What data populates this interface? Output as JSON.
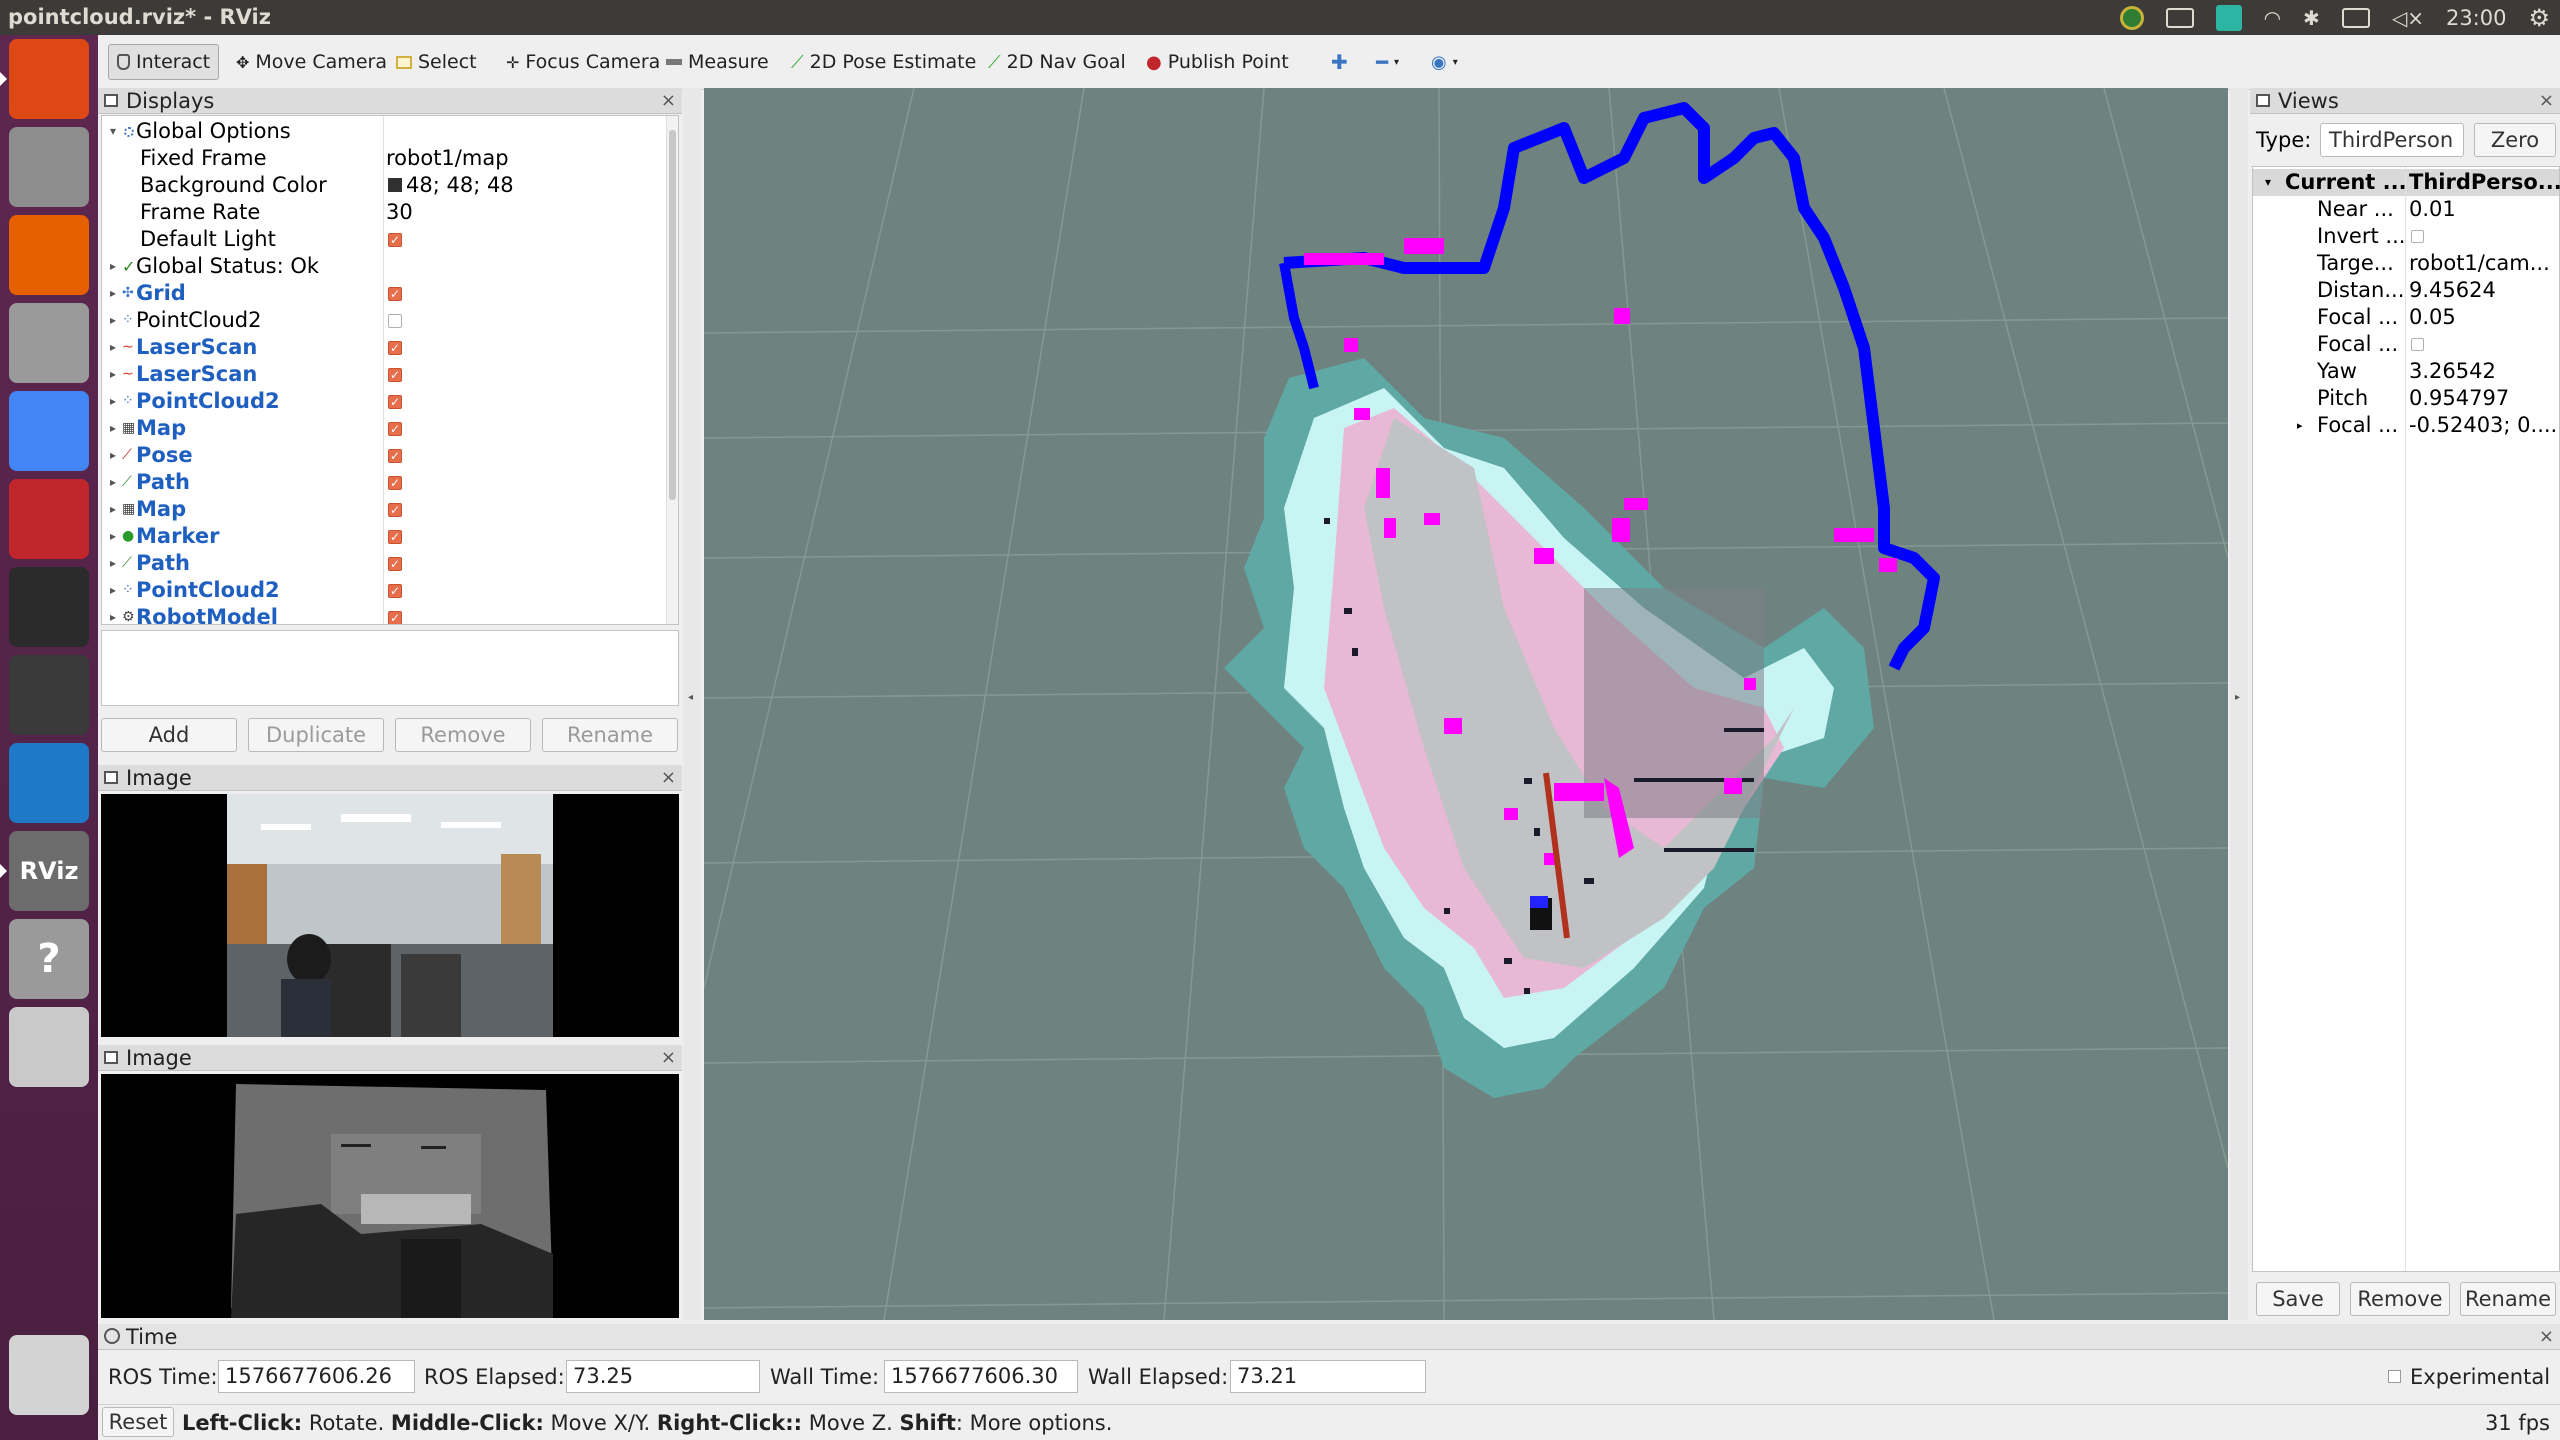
{
  "window": {
    "title": "pointcloud.rviz* - RViz"
  },
  "system_tray": {
    "clock": "23:00"
  },
  "launcher": {
    "items": [
      {
        "name": "ubuntu-dash-icon",
        "color": "#dd4814"
      },
      {
        "name": "files-icon",
        "color": "#8d8d8d"
      },
      {
        "name": "firefox-icon",
        "color": "#e66000"
      },
      {
        "name": "system-settings-icon",
        "color": "#9a9a9a"
      },
      {
        "name": "chrome-icon",
        "color": "#4285f4"
      },
      {
        "name": "terminal-app-icon",
        "color": "#c0262c"
      },
      {
        "name": "system-monitor-icon",
        "color": "#2b2b2b"
      },
      {
        "name": "cheese-camera-icon",
        "color": "#3a3a3a"
      },
      {
        "name": "vscode-icon",
        "color": "#1e7ac9"
      },
      {
        "name": "rviz-icon",
        "color": "#6c6c6c",
        "label": "RViz"
      },
      {
        "name": "help-icon",
        "color": "#9a9a9a",
        "label": "?"
      },
      {
        "name": "disk-icon",
        "color": "#c9c9c9"
      },
      {
        "name": "trash-icon",
        "color": "#d3d3d3"
      }
    ]
  },
  "toolbar": {
    "interact": "Interact",
    "move_camera": "Move Camera",
    "select": "Select",
    "focus_camera": "Focus Camera",
    "measure": "Measure",
    "pose_estimate": "2D Pose Estimate",
    "nav_goal": "2D Nav Goal",
    "publish_point": "Publish Point"
  },
  "displays": {
    "title": "Displays",
    "global_options": "Global Options",
    "props": [
      {
        "key": "Fixed Frame",
        "value": "robot1/map"
      },
      {
        "key": "Background Color",
        "value": "48; 48; 48"
      },
      {
        "key": "Frame Rate",
        "value": "30"
      },
      {
        "key": "Default Light",
        "value": ""
      }
    ],
    "global_status": "Global Status: Ok",
    "items": [
      {
        "label": "Grid",
        "checked": true,
        "bold": true
      },
      {
        "label": "PointCloud2",
        "checked": false,
        "bold": false
      },
      {
        "label": "LaserScan",
        "checked": true,
        "bold": true
      },
      {
        "label": "LaserScan",
        "checked": true,
        "bold": true
      },
      {
        "label": "PointCloud2",
        "checked": true,
        "bold": true
      },
      {
        "label": "Map",
        "checked": true,
        "bold": true
      },
      {
        "label": "Pose",
        "checked": true,
        "bold": true
      },
      {
        "label": "Path",
        "checked": true,
        "bold": true
      },
      {
        "label": "Map",
        "checked": true,
        "bold": true
      },
      {
        "label": "Marker",
        "checked": true,
        "bold": true
      },
      {
        "label": "Path",
        "checked": true,
        "bold": true
      },
      {
        "label": "PointCloud2",
        "checked": true,
        "bold": true
      },
      {
        "label": "RobotModel",
        "checked": true,
        "bold": true
      }
    ],
    "buttons": {
      "add": "Add",
      "duplicate": "Duplicate",
      "remove": "Remove",
      "rename": "Rename"
    }
  },
  "image_panels": [
    {
      "title": "Image"
    },
    {
      "title": "Image"
    }
  ],
  "views": {
    "title": "Views",
    "type_label": "Type:",
    "type_value": "ThirdPerson :",
    "zero": "Zero",
    "current_key": "Current ...",
    "current_value": "ThirdPerso...",
    "props": [
      {
        "key": "Near ...",
        "value": "0.01"
      },
      {
        "key": "Invert ...",
        "value": ""
      },
      {
        "key": "Targe...",
        "value": "robot1/cam..."
      },
      {
        "key": "Distan...",
        "value": "9.45624"
      },
      {
        "key": "Focal ...",
        "value": "0.05"
      },
      {
        "key": "Focal ...",
        "value": ""
      },
      {
        "key": "Yaw",
        "value": "3.26542"
      },
      {
        "key": "Pitch",
        "value": "0.954797"
      },
      {
        "key": "Focal ...",
        "value": "-0.52403; 0...."
      }
    ],
    "buttons": {
      "save": "Save",
      "remove": "Remove",
      "rename": "Rename"
    }
  },
  "time": {
    "title": "Time",
    "ros_time_label": "ROS Time:",
    "ros_time": "1576677606.26",
    "ros_elapsed_label": "ROS Elapsed:",
    "ros_elapsed": "73.25",
    "wall_time_label": "Wall Time:",
    "wall_time": "1576677606.30",
    "wall_elapsed_label": "Wall Elapsed:",
    "wall_elapsed": "73.21",
    "experimental": "Experimental"
  },
  "status": {
    "reset": "Reset",
    "left_click": "Left-Click:",
    "left_click_desc": " Rotate. ",
    "middle_click": "Middle-Click:",
    "middle_click_desc": " Move X/Y. ",
    "right_click": "Right-Click::",
    "right_click_desc": " Move Z. ",
    "shift": "Shift",
    "shift_desc": ": More options.",
    "fps": "31 fps"
  },
  "colors": {
    "view_bg": "#6e837f",
    "scan_blue": "#0000ff",
    "scan_magenta": "#ff00ff",
    "costmap_teal": "#5fa8a4",
    "costmap_cyan": "#c8f4f4",
    "costmap_pink": "#e8b9d4"
  }
}
